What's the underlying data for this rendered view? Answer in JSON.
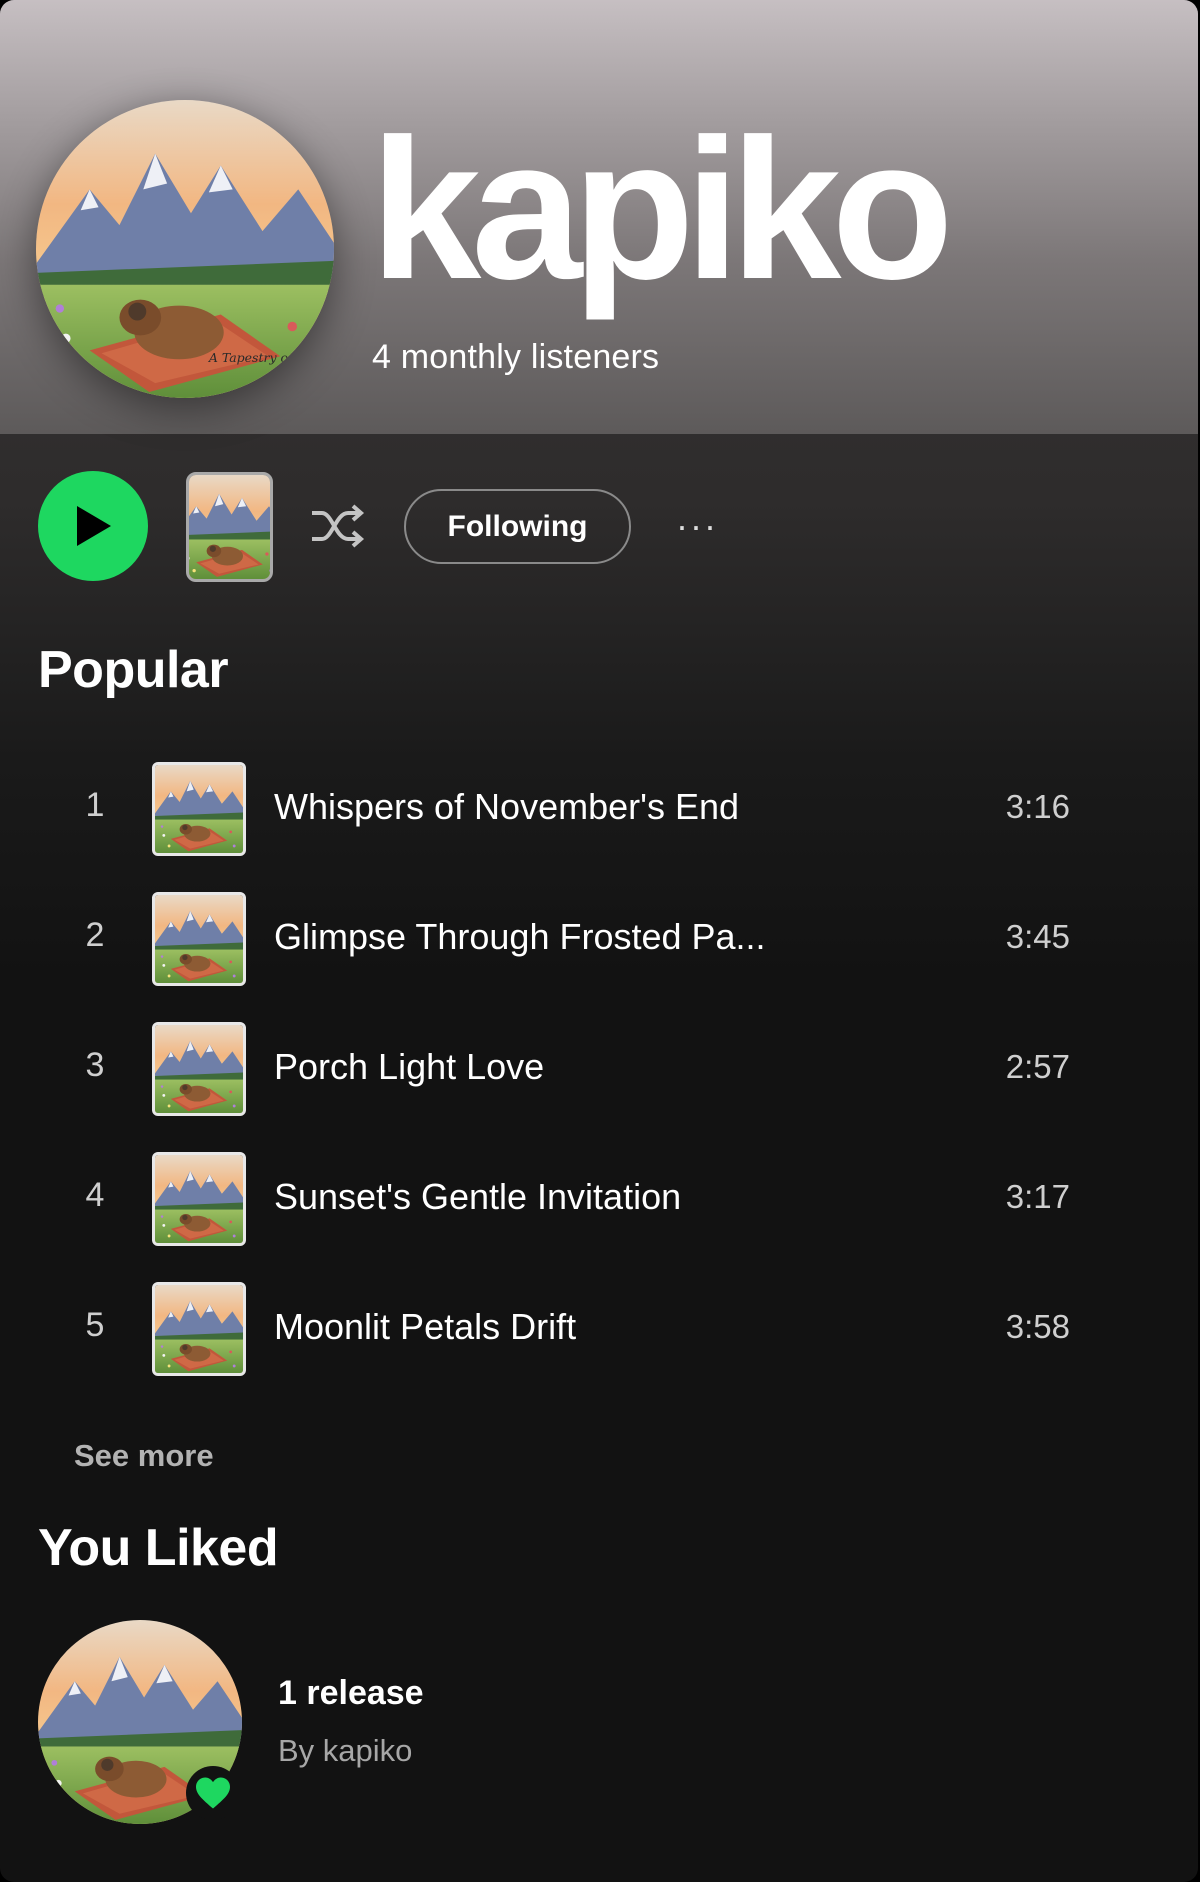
{
  "artist": {
    "name": "kapiko",
    "listeners": "4 monthly listeners",
    "avatar_icon": "landscape-capybara-art",
    "avatar_caption": "A Tapestry of Sol"
  },
  "actions": {
    "play_icon": "play-icon",
    "shuffle_icon": "shuffle-icon",
    "follow_label": "Following",
    "more_label": "···"
  },
  "popular": {
    "heading": "Popular",
    "tracks": [
      {
        "num": "1",
        "title": "Whispers of November's End",
        "duration": "3:16"
      },
      {
        "num": "2",
        "title": "Glimpse Through Frosted Pa...",
        "duration": "3:45"
      },
      {
        "num": "3",
        "title": "Porch Light Love",
        "duration": "2:57"
      },
      {
        "num": "4",
        "title": "Sunset's Gentle Invitation",
        "duration": "3:17"
      },
      {
        "num": "5",
        "title": "Moonlit Petals Drift",
        "duration": "3:58"
      }
    ],
    "see_more": "See more"
  },
  "liked": {
    "heading": "You Liked",
    "title": "1 release",
    "subtitle": "By kapiko",
    "badge_icon": "heart-icon"
  },
  "colors": {
    "accent": "#1ed760",
    "background": "#121212"
  }
}
